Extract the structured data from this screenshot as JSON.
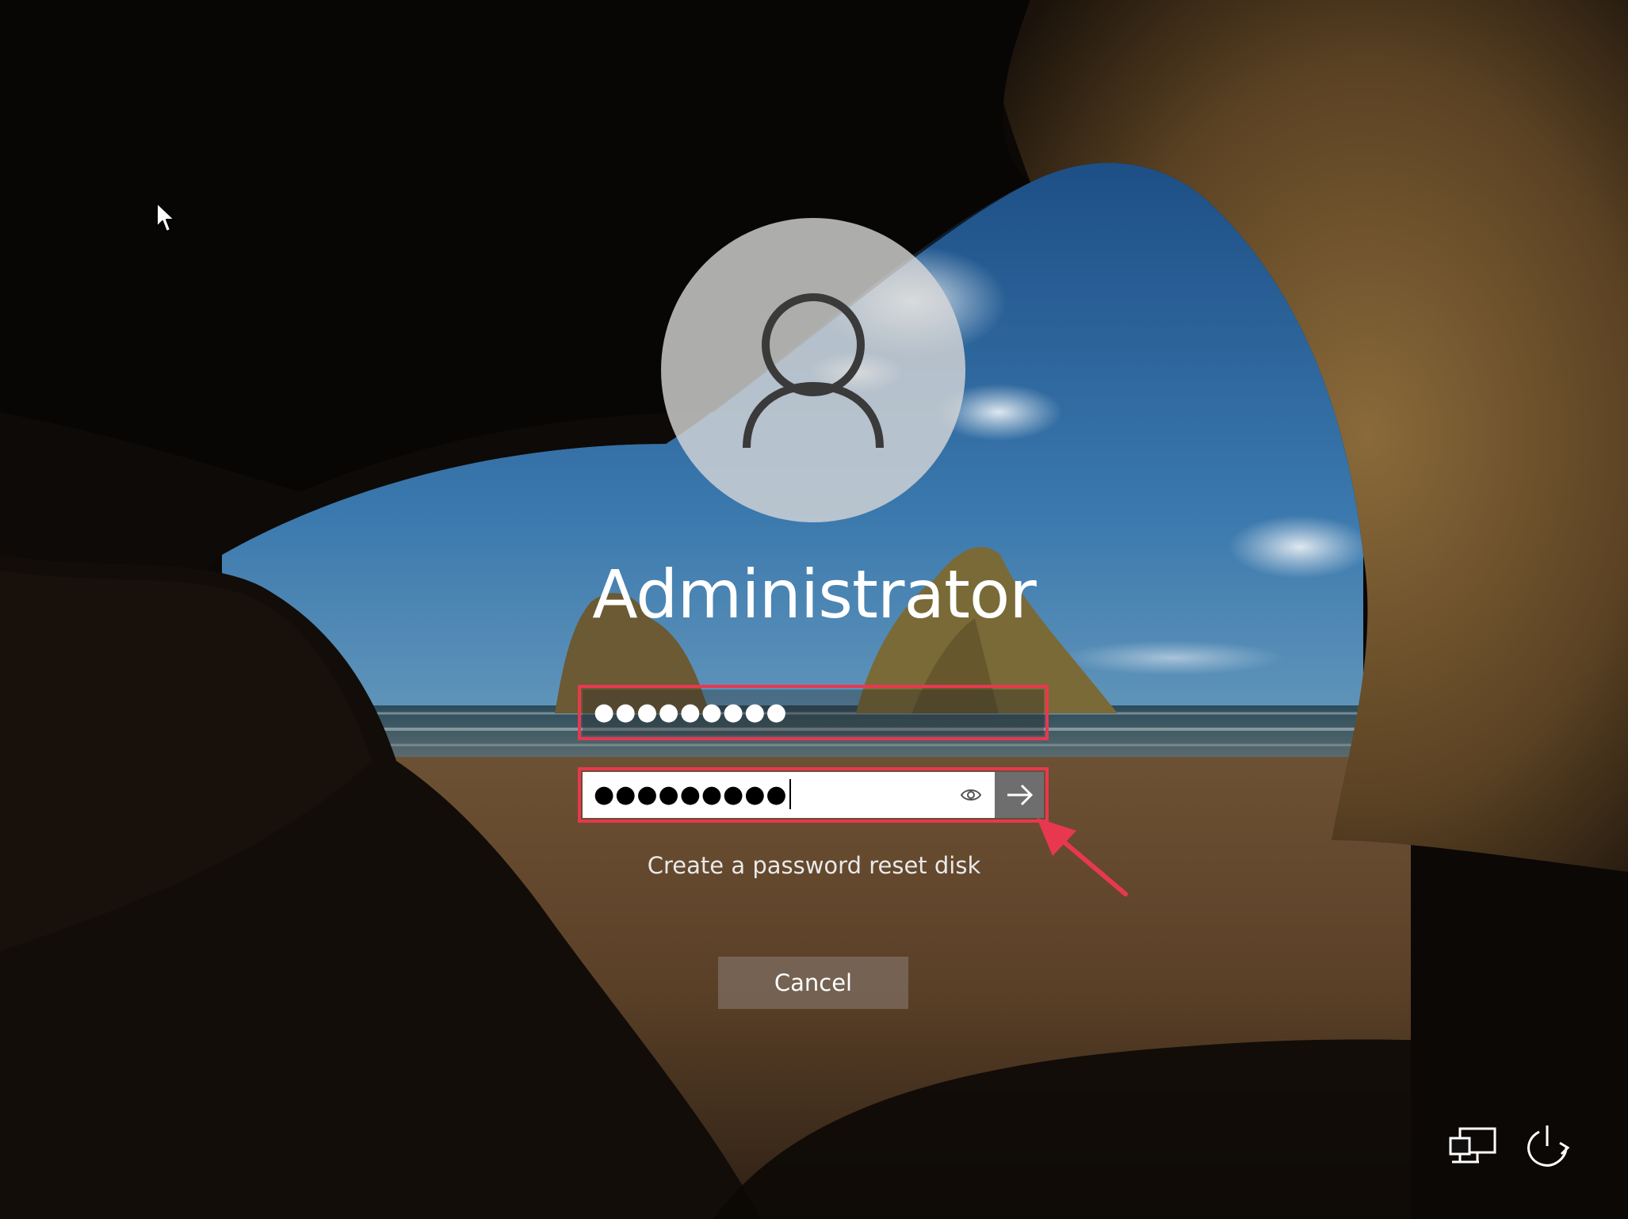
{
  "user": {
    "name": "Administrator"
  },
  "fields": {
    "first_value": "●●●●●●●●●",
    "password_value": "●●●●●●●●●"
  },
  "links": {
    "reset_disk": "Create a password reset disk"
  },
  "buttons": {
    "cancel": "Cancel"
  },
  "icons": {
    "avatar": "user-silhouette-icon",
    "reveal": "eye-icon",
    "submit": "arrow-right-icon",
    "network": "network-icon",
    "power": "power-icon",
    "cursor": "mouse-pointer-icon"
  },
  "colors": {
    "highlight": "#e8384f",
    "submit_bg": "#6e6e6e",
    "cancel_bg": "#7d6e62"
  }
}
